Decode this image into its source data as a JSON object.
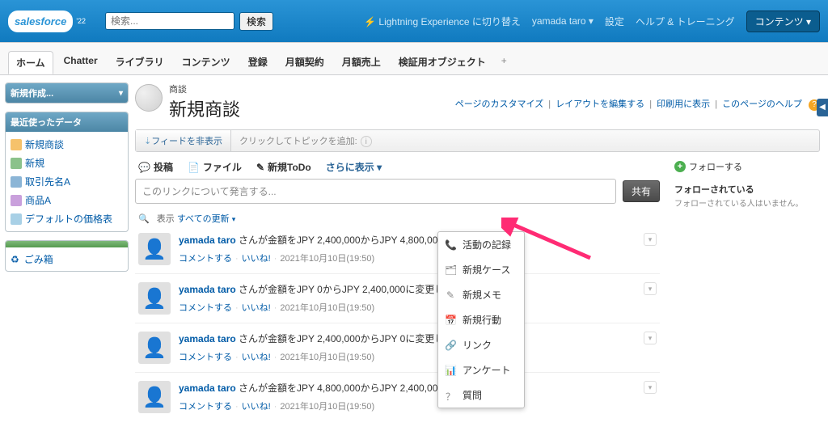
{
  "brand": "salesforce",
  "brand_badge": "'22",
  "search": {
    "placeholder": "検索...",
    "button": "検索"
  },
  "top_links": {
    "lightning": "Lightning Experience に切り替え",
    "user": "yamada taro",
    "settings": "設定",
    "help": "ヘルプ & トレーニング",
    "content": "コンテンツ"
  },
  "nav": {
    "tabs": [
      "ホーム",
      "Chatter",
      "ライブラリ",
      "コンテンツ",
      "登録",
      "月額契約",
      "月額売上",
      "検証用オブジェクト"
    ]
  },
  "sidebar": {
    "new": "新規作成...",
    "recent_hd": "最近使ったデータ",
    "recent": [
      "新規商談",
      "新規",
      "取引先名A",
      "商品A",
      "デフォルトの価格表"
    ],
    "trash_hd": " ",
    "trash": "ごみ箱"
  },
  "page": {
    "kicker": "商談",
    "title": "新規商談",
    "links": {
      "customize": "ページのカスタマイズ",
      "layout": "レイアウトを編集する",
      "print": "印刷用に表示",
      "help": "このページのヘルプ"
    }
  },
  "feedbar": {
    "hide": "フィードを非表示",
    "topic": "クリックしてトピックを追加:"
  },
  "publisher": {
    "tabs": {
      "post": "投稿",
      "file": "ファイル",
      "todo": "新規ToDo",
      "more": "さらに表示"
    },
    "placeholder": "このリンクについて発言する...",
    "share": "共有"
  },
  "dropdown": {
    "items": [
      "活動の記録",
      "新規ケース",
      "新規メモ",
      "新規行動",
      "リンク",
      "アンケート",
      "質問"
    ]
  },
  "filter": {
    "show": "表示",
    "all": "すべての更新"
  },
  "follow": {
    "btn": "フォローする",
    "hd": "フォローされている",
    "empty": "フォローされている人はいません。"
  },
  "feed": {
    "user": "yamada taro",
    "comment": "コメントする",
    "like": "いいね!",
    "items": [
      {
        "text": " さんが金額をJPY 2,400,000からJPY 4,800,000に変更しました。",
        "date": "2021年10月10日(19:50)"
      },
      {
        "text": " さんが金額をJPY 0からJPY 2,400,000に変更しました。",
        "date": "2021年10月10日(19:50)"
      },
      {
        "text": " さんが金額をJPY 2,400,000からJPY 0に変更しました。",
        "date": "2021年10月10日(19:50)"
      },
      {
        "text": " さんが金額をJPY 4,800,000からJPY 2,400,000に変更しました。",
        "date": "2021年10月10日(19:50)"
      }
    ]
  }
}
